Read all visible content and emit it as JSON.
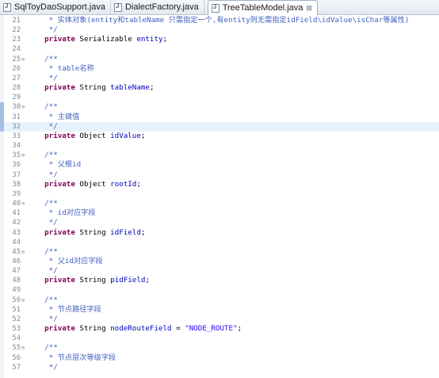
{
  "tabs": [
    {
      "label": "SqlToyDaoSupport.java",
      "active": false
    },
    {
      "label": "DialectFactory.java",
      "active": false
    },
    {
      "label": "TreeTableModel.java",
      "active": true,
      "close": "⊠"
    }
  ],
  "editor": {
    "current_line": 32,
    "lines": [
      {
        "n": "21",
        "fold": "",
        "parts": [
          {
            "t": "     * 实体对象(entity和tableName 只需指定一个,有entity则无需指定idField\\idValue\\isChar等属性)",
            "c": "cm"
          }
        ]
      },
      {
        "n": "22",
        "fold": "",
        "parts": [
          {
            "t": "     */",
            "c": "cm"
          }
        ]
      },
      {
        "n": "23",
        "fold": "",
        "parts": [
          {
            "t": "    ",
            "c": ""
          },
          {
            "t": "private",
            "c": "kw"
          },
          {
            "t": " Serializable ",
            "c": ""
          },
          {
            "t": "entity",
            "c": "fd"
          },
          {
            "t": ";",
            "c": ""
          }
        ]
      },
      {
        "n": "24",
        "fold": "",
        "parts": []
      },
      {
        "n": "25",
        "fold": "⊖",
        "parts": [
          {
            "t": "    /**",
            "c": "cm"
          }
        ]
      },
      {
        "n": "26",
        "fold": "",
        "parts": [
          {
            "t": "     * table名称",
            "c": "cm"
          }
        ]
      },
      {
        "n": "27",
        "fold": "",
        "parts": [
          {
            "t": "     */",
            "c": "cm"
          }
        ]
      },
      {
        "n": "28",
        "fold": "",
        "parts": [
          {
            "t": "    ",
            "c": ""
          },
          {
            "t": "private",
            "c": "kw"
          },
          {
            "t": " String ",
            "c": ""
          },
          {
            "t": "tableName",
            "c": "fd"
          },
          {
            "t": ";",
            "c": ""
          }
        ]
      },
      {
        "n": "29",
        "fold": "",
        "parts": []
      },
      {
        "n": "30",
        "fold": "⊖",
        "parts": [
          {
            "t": "    /**",
            "c": "cm"
          }
        ]
      },
      {
        "n": "31",
        "fold": "",
        "parts": [
          {
            "t": "     * 主键值",
            "c": "cm"
          }
        ]
      },
      {
        "n": "32",
        "fold": "",
        "parts": [
          {
            "t": "     */",
            "c": "cm"
          }
        ]
      },
      {
        "n": "33",
        "fold": "",
        "parts": [
          {
            "t": "    ",
            "c": ""
          },
          {
            "t": "private",
            "c": "kw"
          },
          {
            "t": " Object ",
            "c": ""
          },
          {
            "t": "idValue",
            "c": "fd"
          },
          {
            "t": ";",
            "c": ""
          }
        ]
      },
      {
        "n": "34",
        "fold": "",
        "parts": []
      },
      {
        "n": "35",
        "fold": "⊖",
        "parts": [
          {
            "t": "    /**",
            "c": "cm"
          }
        ]
      },
      {
        "n": "36",
        "fold": "",
        "parts": [
          {
            "t": "     * 父根id",
            "c": "cm"
          }
        ]
      },
      {
        "n": "37",
        "fold": "",
        "parts": [
          {
            "t": "     */",
            "c": "cm"
          }
        ]
      },
      {
        "n": "38",
        "fold": "",
        "parts": [
          {
            "t": "    ",
            "c": ""
          },
          {
            "t": "private",
            "c": "kw"
          },
          {
            "t": " Object ",
            "c": ""
          },
          {
            "t": "rootId",
            "c": "fd"
          },
          {
            "t": ";",
            "c": ""
          }
        ]
      },
      {
        "n": "39",
        "fold": "",
        "parts": []
      },
      {
        "n": "40",
        "fold": "⊖",
        "parts": [
          {
            "t": "    /**",
            "c": "cm"
          }
        ]
      },
      {
        "n": "41",
        "fold": "",
        "parts": [
          {
            "t": "     * id对应字段",
            "c": "cm"
          }
        ]
      },
      {
        "n": "42",
        "fold": "",
        "parts": [
          {
            "t": "     */",
            "c": "cm"
          }
        ]
      },
      {
        "n": "43",
        "fold": "",
        "parts": [
          {
            "t": "    ",
            "c": ""
          },
          {
            "t": "private",
            "c": "kw"
          },
          {
            "t": " String ",
            "c": ""
          },
          {
            "t": "idField",
            "c": "fd"
          },
          {
            "t": ";",
            "c": ""
          }
        ]
      },
      {
        "n": "44",
        "fold": "",
        "parts": []
      },
      {
        "n": "45",
        "fold": "⊖",
        "parts": [
          {
            "t": "    /**",
            "c": "cm"
          }
        ]
      },
      {
        "n": "46",
        "fold": "",
        "parts": [
          {
            "t": "     * 父id对应字段",
            "c": "cm"
          }
        ]
      },
      {
        "n": "47",
        "fold": "",
        "parts": [
          {
            "t": "     */",
            "c": "cm"
          }
        ]
      },
      {
        "n": "48",
        "fold": "",
        "parts": [
          {
            "t": "    ",
            "c": ""
          },
          {
            "t": "private",
            "c": "kw"
          },
          {
            "t": " String ",
            "c": ""
          },
          {
            "t": "pidField",
            "c": "fd"
          },
          {
            "t": ";",
            "c": ""
          }
        ]
      },
      {
        "n": "49",
        "fold": "",
        "parts": []
      },
      {
        "n": "50",
        "fold": "⊖",
        "parts": [
          {
            "t": "    /**",
            "c": "cm"
          }
        ]
      },
      {
        "n": "51",
        "fold": "",
        "parts": [
          {
            "t": "     * 节点路径字段",
            "c": "cm"
          }
        ]
      },
      {
        "n": "52",
        "fold": "",
        "parts": [
          {
            "t": "     */",
            "c": "cm"
          }
        ]
      },
      {
        "n": "53",
        "fold": "",
        "parts": [
          {
            "t": "    ",
            "c": ""
          },
          {
            "t": "private",
            "c": "kw"
          },
          {
            "t": " String ",
            "c": ""
          },
          {
            "t": "nodeRouteField",
            "c": "fd"
          },
          {
            "t": " = ",
            "c": ""
          },
          {
            "t": "\"NODE_ROUTE\"",
            "c": "st"
          },
          {
            "t": ";",
            "c": ""
          }
        ]
      },
      {
        "n": "54",
        "fold": "",
        "parts": []
      },
      {
        "n": "55",
        "fold": "⊖",
        "parts": [
          {
            "t": "    /**",
            "c": "cm"
          }
        ]
      },
      {
        "n": "56",
        "fold": "",
        "parts": [
          {
            "t": "     * 节点层次等级字段",
            "c": "cm"
          }
        ]
      },
      {
        "n": "57",
        "fold": "",
        "parts": [
          {
            "t": "     */",
            "c": "cm"
          }
        ]
      }
    ]
  },
  "colors": {
    "keyword": "#7f0055",
    "comment": "#3f5fbf",
    "field": "#0000c0",
    "string": "#2a00ff",
    "current_line": "#e8f2fe"
  }
}
